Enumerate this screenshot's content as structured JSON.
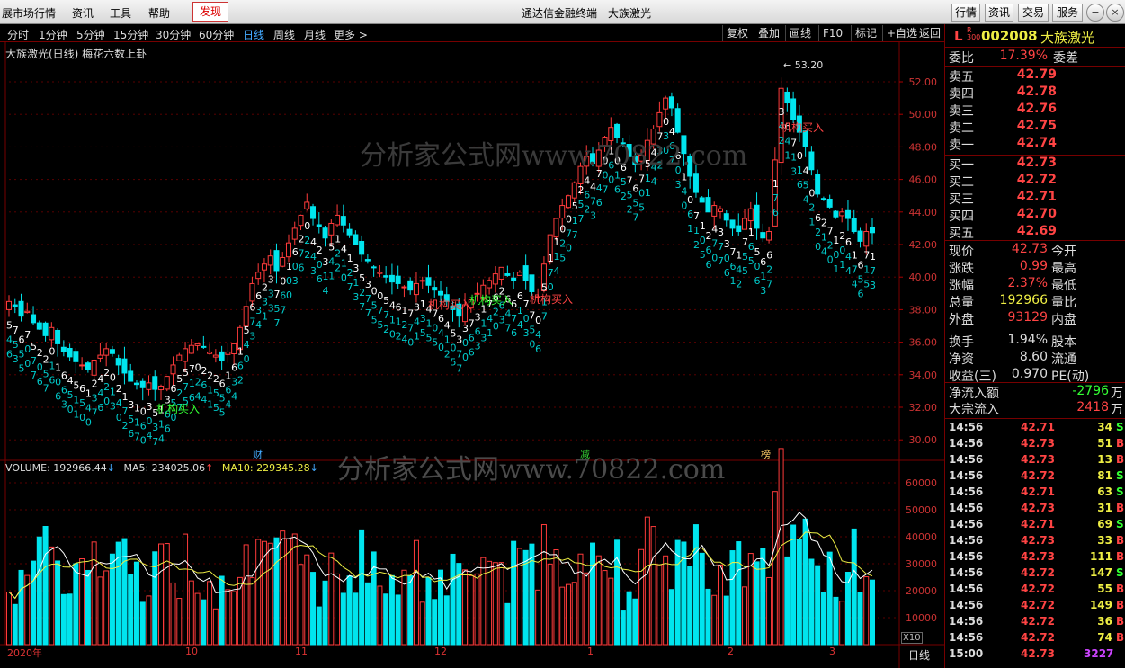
{
  "menubar": {
    "items": [
      "展市场行情",
      "资讯",
      "工具",
      "帮助"
    ],
    "find": "发现",
    "title": "通达信金融终端　大族激光",
    "right_buttons": [
      "行情",
      "资讯",
      "交易",
      "服务"
    ]
  },
  "periods": {
    "items": [
      "分时",
      "1分钟",
      "5分钟",
      "15分钟",
      "30分钟",
      "60分钟",
      "日线",
      "周线",
      "月线",
      "更多 >"
    ],
    "active": "日线"
  },
  "toolbar": [
    "复权",
    "叠加",
    "画线",
    "F10",
    "标记",
    "+自选",
    "返回"
  ],
  "chart": {
    "label": "大族激光(日线) 梅花六数上卦",
    "price_axis": [
      "52.00",
      "50.00",
      "48.00",
      "46.00",
      "44.00",
      "42.00",
      "40.00",
      "38.00",
      "36.00",
      "34.00",
      "32.00",
      "30.00"
    ],
    "high_marker": "53.20",
    "signals": [
      "机构买入",
      "机构买入",
      "机构买入",
      "机构买入",
      "机构买入"
    ],
    "event_tags": [
      "财",
      "减",
      "榜"
    ],
    "watermark": "分析家公式网www.70822.com",
    "watermark2": "分析家公式网www.70822.com",
    "bull_color": "#ff3b3b",
    "bear_color": "#00e5ee"
  },
  "volume": {
    "volume_label": "VOLUME: 192966.44",
    "ma5_label": "MA5: 234025.06",
    "ma10_label": "MA10: 229345.28",
    "axis": [
      "60000",
      "50000",
      "40000",
      "30000",
      "20000",
      "10000"
    ],
    "unit": "X10"
  },
  "date_axis": [
    "2020年",
    "10",
    "11",
    "12",
    "1",
    "2",
    "3"
  ],
  "period_tab": "日线",
  "stock": {
    "code": "002008",
    "name": "大族激光",
    "flag": "L",
    "flag_sub": "R 300"
  },
  "order_book": {
    "weibi_label": "委比",
    "weibi": "17.39%",
    "weicha_label": "委差",
    "sells": [
      {
        "label": "卖五",
        "price": "42.79"
      },
      {
        "label": "卖四",
        "price": "42.78"
      },
      {
        "label": "卖三",
        "price": "42.76"
      },
      {
        "label": "卖二",
        "price": "42.75"
      },
      {
        "label": "卖一",
        "price": "42.74"
      }
    ],
    "buys": [
      {
        "label": "买一",
        "price": "42.73"
      },
      {
        "label": "买二",
        "price": "42.72"
      },
      {
        "label": "买三",
        "price": "42.71"
      },
      {
        "label": "买四",
        "price": "42.70"
      },
      {
        "label": "买五",
        "price": "42.69"
      }
    ]
  },
  "quote": [
    {
      "l1": "现价",
      "v1": "42.73",
      "l2": "今开",
      "c": "#f44"
    },
    {
      "l1": "涨跌",
      "v1": "0.99",
      "l2": "最高",
      "c": "#f44"
    },
    {
      "l1": "涨幅",
      "v1": "2.37%",
      "l2": "最低",
      "c": "#f44"
    },
    {
      "l1": "总量",
      "v1": "192966",
      "l2": "量比",
      "c": "#ee4"
    },
    {
      "l1": "外盘",
      "v1": "93129",
      "l2": "内盘",
      "c": "#f44"
    },
    {
      "l1": "换手",
      "v1": "1.94%",
      "l2": "股本",
      "c": "#ddd"
    },
    {
      "l1": "净资",
      "v1": "8.60",
      "l2": "流通",
      "c": "#ddd"
    },
    {
      "l1": "收益(三)",
      "v1": "0.970",
      "l2": "PE(动)",
      "c": "#ddd"
    }
  ],
  "flows": [
    {
      "label": "净流入额",
      "value": "-2796",
      "unit": "万",
      "c": "#3f3"
    },
    {
      "label": "大宗流入",
      "value": "2418",
      "unit": "万",
      "c": "#f44"
    }
  ],
  "ticks": [
    {
      "t": "14:56",
      "p": "42.71",
      "v": "34",
      "s": "S"
    },
    {
      "t": "14:56",
      "p": "42.73",
      "v": "51",
      "s": "B"
    },
    {
      "t": "14:56",
      "p": "42.73",
      "v": "13",
      "s": "B"
    },
    {
      "t": "14:56",
      "p": "42.72",
      "v": "81",
      "s": "S"
    },
    {
      "t": "14:56",
      "p": "42.71",
      "v": "63",
      "s": "S"
    },
    {
      "t": "14:56",
      "p": "42.73",
      "v": "31",
      "s": "B"
    },
    {
      "t": "14:56",
      "p": "42.71",
      "v": "69",
      "s": "S"
    },
    {
      "t": "14:56",
      "p": "42.73",
      "v": "33",
      "s": "B"
    },
    {
      "t": "14:56",
      "p": "42.73",
      "v": "111",
      "s": "B"
    },
    {
      "t": "14:56",
      "p": "42.72",
      "v": "147",
      "s": "S"
    },
    {
      "t": "14:56",
      "p": "42.72",
      "v": "55",
      "s": "B"
    },
    {
      "t": "14:56",
      "p": "42.72",
      "v": "149",
      "s": "B"
    },
    {
      "t": "14:56",
      "p": "42.72",
      "v": "36",
      "s": "B"
    },
    {
      "t": "14:56",
      "p": "42.72",
      "v": "74",
      "s": "B"
    },
    {
      "t": "15:00",
      "p": "42.73",
      "v": "3227",
      "s": ""
    }
  ]
}
